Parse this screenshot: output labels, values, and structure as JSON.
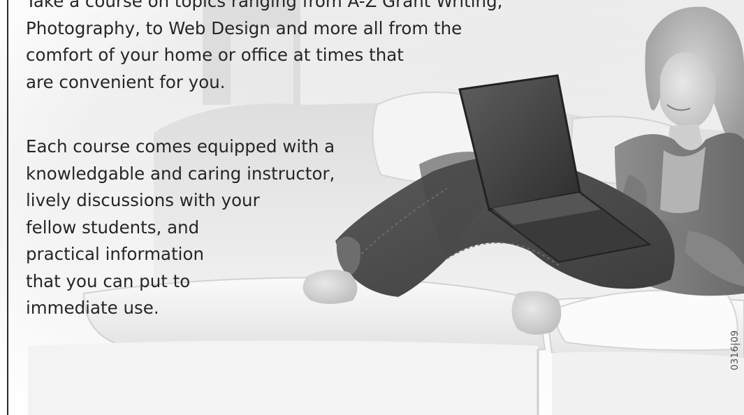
{
  "paragraphs": [
    {
      "lines": [
        "Take a course on topics ranging from A-Z Grant Writing,",
        "Photography, to Web Design and more all from the",
        "comfort of your home or office at times that",
        "are convenient for you."
      ]
    },
    {
      "lines": [
        "Each course comes equipped with a",
        "knowledgable and caring instructor,",
        "lively discussions with your",
        "fellow students, and",
        "practical information",
        "that you can put to",
        "immediate use."
      ]
    }
  ],
  "reference_code": "0316|09",
  "photo": {
    "subject": "woman-using-laptop-on-sofa",
    "tone": "grayscale"
  }
}
